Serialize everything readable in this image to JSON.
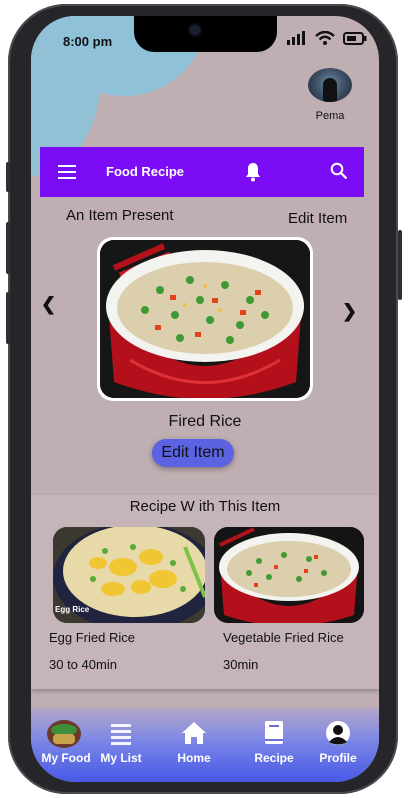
{
  "status": {
    "time": "8:00 pm"
  },
  "profile": {
    "name": "Pema"
  },
  "appbar": {
    "title": "Food Recipe"
  },
  "section": {
    "left_label": "An Item Present",
    "right_label": "Edit Item"
  },
  "item": {
    "name": "Fired Rice",
    "edit_label": "Edit Item"
  },
  "recipes": {
    "title": "Recipe W ith This Item",
    "cards": [
      {
        "name": "Egg Fried Rice",
        "time": "30 to 40min",
        "badge": "Egg Rice"
      },
      {
        "name": "Vegetable Fried Rice",
        "time": "30min"
      }
    ]
  },
  "nav": {
    "items": [
      {
        "label": "My Food",
        "icon": "food-thumbnail-icon"
      },
      {
        "label": "My List",
        "icon": "list-icon"
      },
      {
        "label": "Home",
        "icon": "home-icon"
      },
      {
        "label": "Recipe",
        "icon": "book-icon"
      },
      {
        "label": "Profile",
        "icon": "person-icon"
      }
    ]
  },
  "colors": {
    "appbar": "#7a0cf6",
    "screen_bg": "#c0afb2",
    "accent_button": "#5b63e2",
    "nav_gradient_end": "#4758e6"
  }
}
